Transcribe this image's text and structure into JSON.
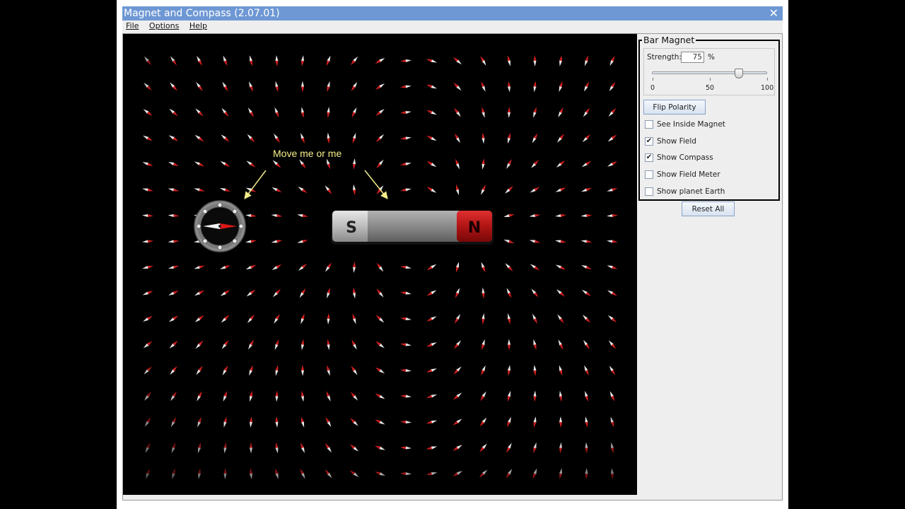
{
  "window": {
    "title": "Magnet and Compass (2.07.01)",
    "close_icon": "close-icon"
  },
  "menu": [
    "File",
    "Options",
    "Help"
  ],
  "play": {
    "hint": "Move me or me",
    "magnet": {
      "south": "S",
      "north": "N"
    }
  },
  "control": {
    "panel_title": "Bar Magnet",
    "strength_label": "Strength:",
    "strength_value": "75",
    "strength_unit": "%",
    "slider": {
      "min": 0,
      "max": 100,
      "value": 75,
      "ticks": [
        "0",
        "50",
        "100"
      ]
    },
    "flip_label": "Flip Polarity",
    "checkboxes": [
      {
        "label": "See Inside Magnet",
        "checked": false
      },
      {
        "label": "Show Field",
        "checked": true
      },
      {
        "label": "Show Compass",
        "checked": true
      },
      {
        "label": "Show Field Meter",
        "checked": false
      },
      {
        "label": "Show planet Earth",
        "checked": false
      }
    ],
    "reset_label": "Reset All"
  },
  "colors": {
    "titlebar": "#6e98d4",
    "hint": "#f5f08a",
    "magnet_north": "#c21818",
    "magnet_south": "#c8c8c8"
  }
}
